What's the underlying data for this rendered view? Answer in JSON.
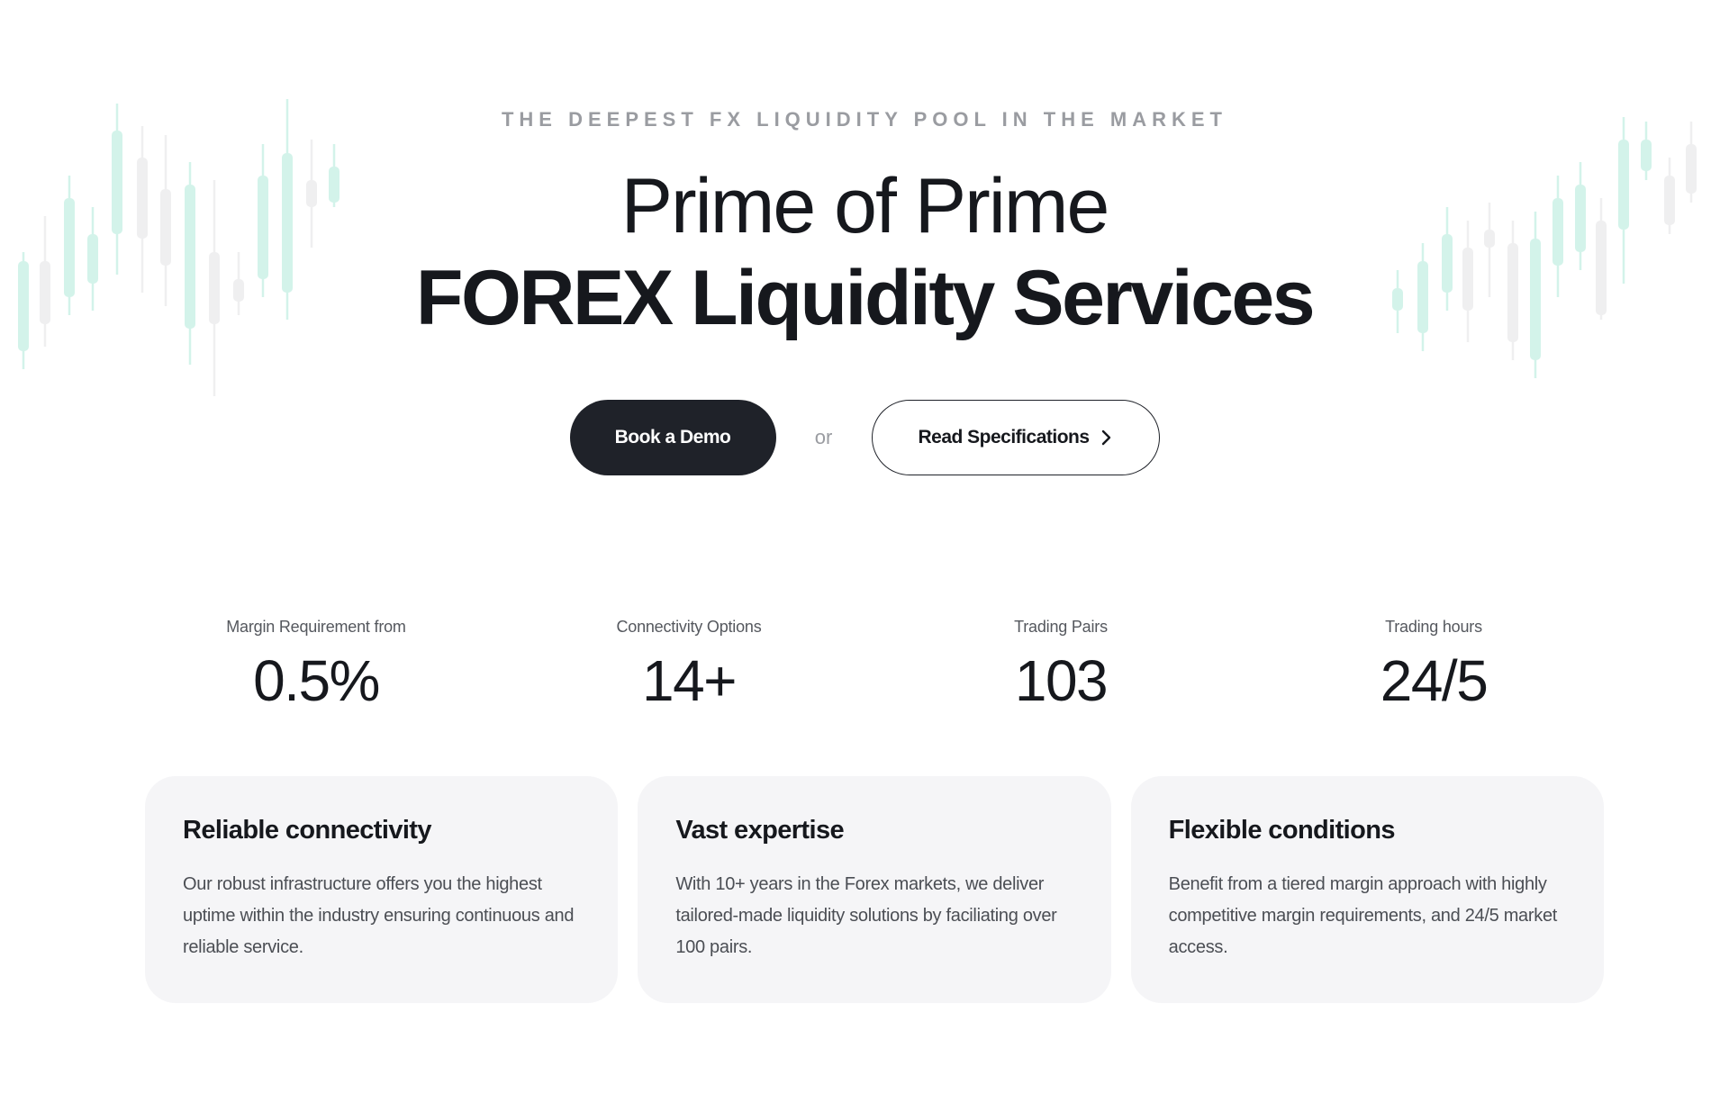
{
  "hero": {
    "eyebrow": "THE DEEPEST FX LIQUIDITY POOL IN THE MARKET",
    "headline_line1": "Prime of Prime",
    "headline_line2": "FOREX Liquidity Services"
  },
  "cta": {
    "primary_label": "Book a Demo",
    "separator": "or",
    "secondary_label": "Read Specifications"
  },
  "stats": [
    {
      "label": "Margin Requirement from",
      "value": "0.5%"
    },
    {
      "label": "Connectivity Options",
      "value": "14+"
    },
    {
      "label": "Trading Pairs",
      "value": "103"
    },
    {
      "label": "Trading hours",
      "value": "24/5"
    }
  ],
  "features": [
    {
      "title": "Reliable connectivity",
      "body": "Our robust infrastructure offers you the highest uptime within the industry ensuring continuous and reliable service."
    },
    {
      "title": "Vast expertise",
      "body": "With 10+ years in the Forex markets, we deliver tailored-made liquidity solutions by faciliating over 100 pairs."
    },
    {
      "title": "Flexible conditions",
      "body": "Benefit from a tiered margin approach with highly competitive margin requirements, and 24/5 market access."
    }
  ],
  "colors": {
    "candle_up": "#d3f3ea",
    "candle_down": "#efeff0",
    "primary_button": "#1f2229",
    "card_background": "#f5f5f7"
  },
  "icons": {
    "secondary_button_icon": "chevron-right-icon"
  }
}
